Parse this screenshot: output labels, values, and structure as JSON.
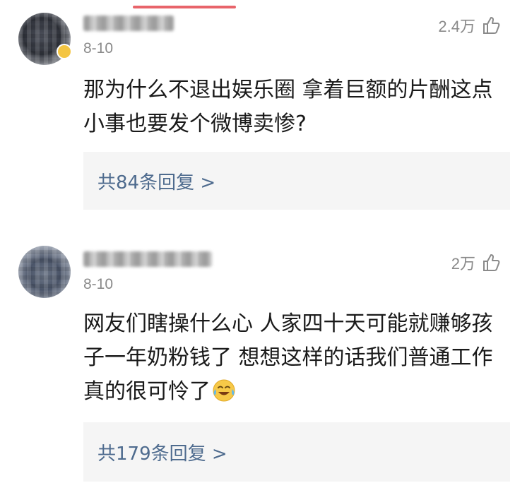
{
  "comments": [
    {
      "date": "8-10",
      "likes": "2.4万",
      "text": "那为什么不退出娱乐圈 拿着巨额的片酬这点小事也要发个微博卖惨?",
      "replies_label": "共84条回复 >"
    },
    {
      "date": "8-10",
      "likes": "2万",
      "text": "网友们瞎操什么心 人家四十天可能就赚够孩子一年奶粉钱了 想想这样的话我们普通工作真的很可怜了",
      "emoji": "laugh-cry-emoji",
      "replies_label": "共179条回复 >"
    }
  ],
  "colors": {
    "accent": "#e8646a",
    "reply_link": "#4e6b8e",
    "meta_text": "#8a8a8a",
    "reply_bg": "#f5f5f5"
  },
  "icons": {
    "like": "thumbs-up-icon"
  }
}
